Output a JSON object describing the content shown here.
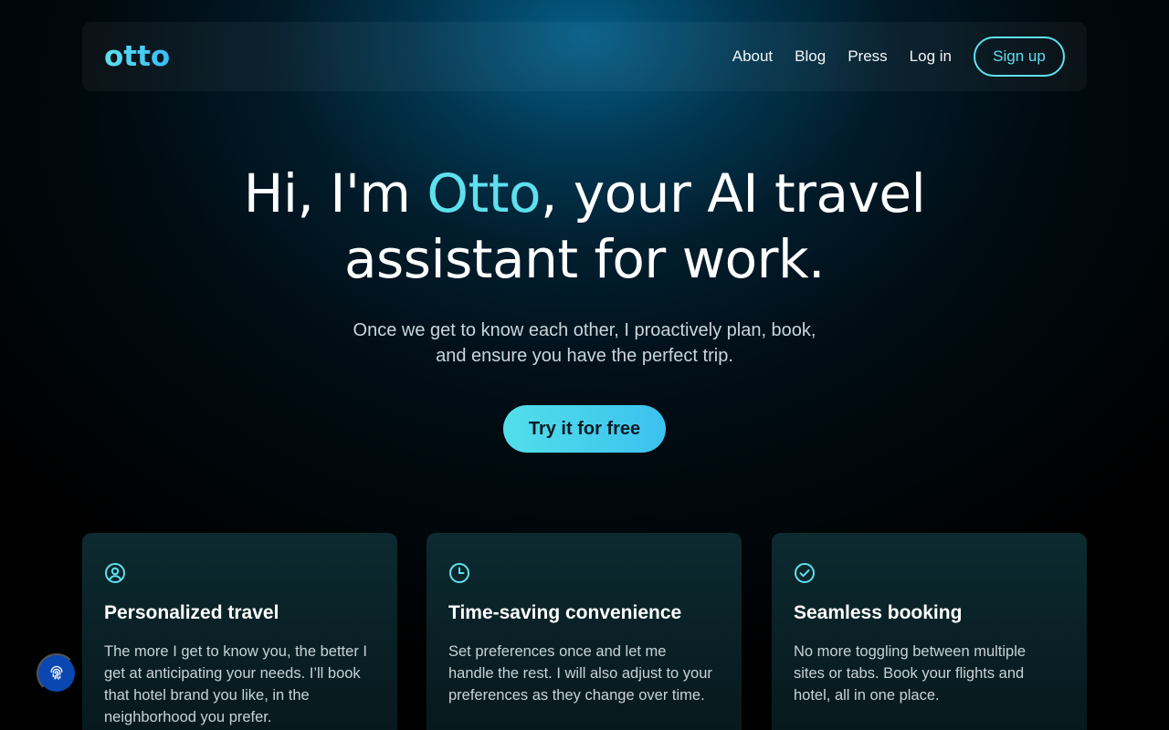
{
  "nav": {
    "logo": "otto",
    "links": [
      "About",
      "Blog",
      "Press",
      "Log in"
    ],
    "signup": "Sign up"
  },
  "hero": {
    "title_before": "Hi, I'm ",
    "title_accent": "Otto",
    "title_line1_after": ", your AI travel",
    "title_line2": "assistant for work.",
    "subtitle_line1": "Once we get to know each other, I proactively plan, book,",
    "subtitle_line2": "and ensure you have the perfect trip.",
    "cta": "Try it for free"
  },
  "features": [
    {
      "icon": "user-circle-icon",
      "title": "Personalized travel",
      "body": "The more I get to know you, the better I get at anticipating your needs. I’ll book that hotel brand you like, in the neighborhood you prefer."
    },
    {
      "icon": "clock-icon",
      "title": "Time-saving convenience",
      "body": "Set preferences once and let me handle the rest. I will also adjust to your preferences as they change over time."
    },
    {
      "icon": "check-circle-icon",
      "title": "Seamless booking",
      "body": "No more toggling between multiple sites or tabs. Book your flights and hotel, all in one place."
    }
  ],
  "colors": {
    "accent": "#5fe0ee",
    "cta_gradient_start": "#52dfe9",
    "cta_gradient_end": "#3cc1ef",
    "fingerprint_button": "#0b47b0"
  },
  "floating_button_icon": "fingerprint-icon"
}
